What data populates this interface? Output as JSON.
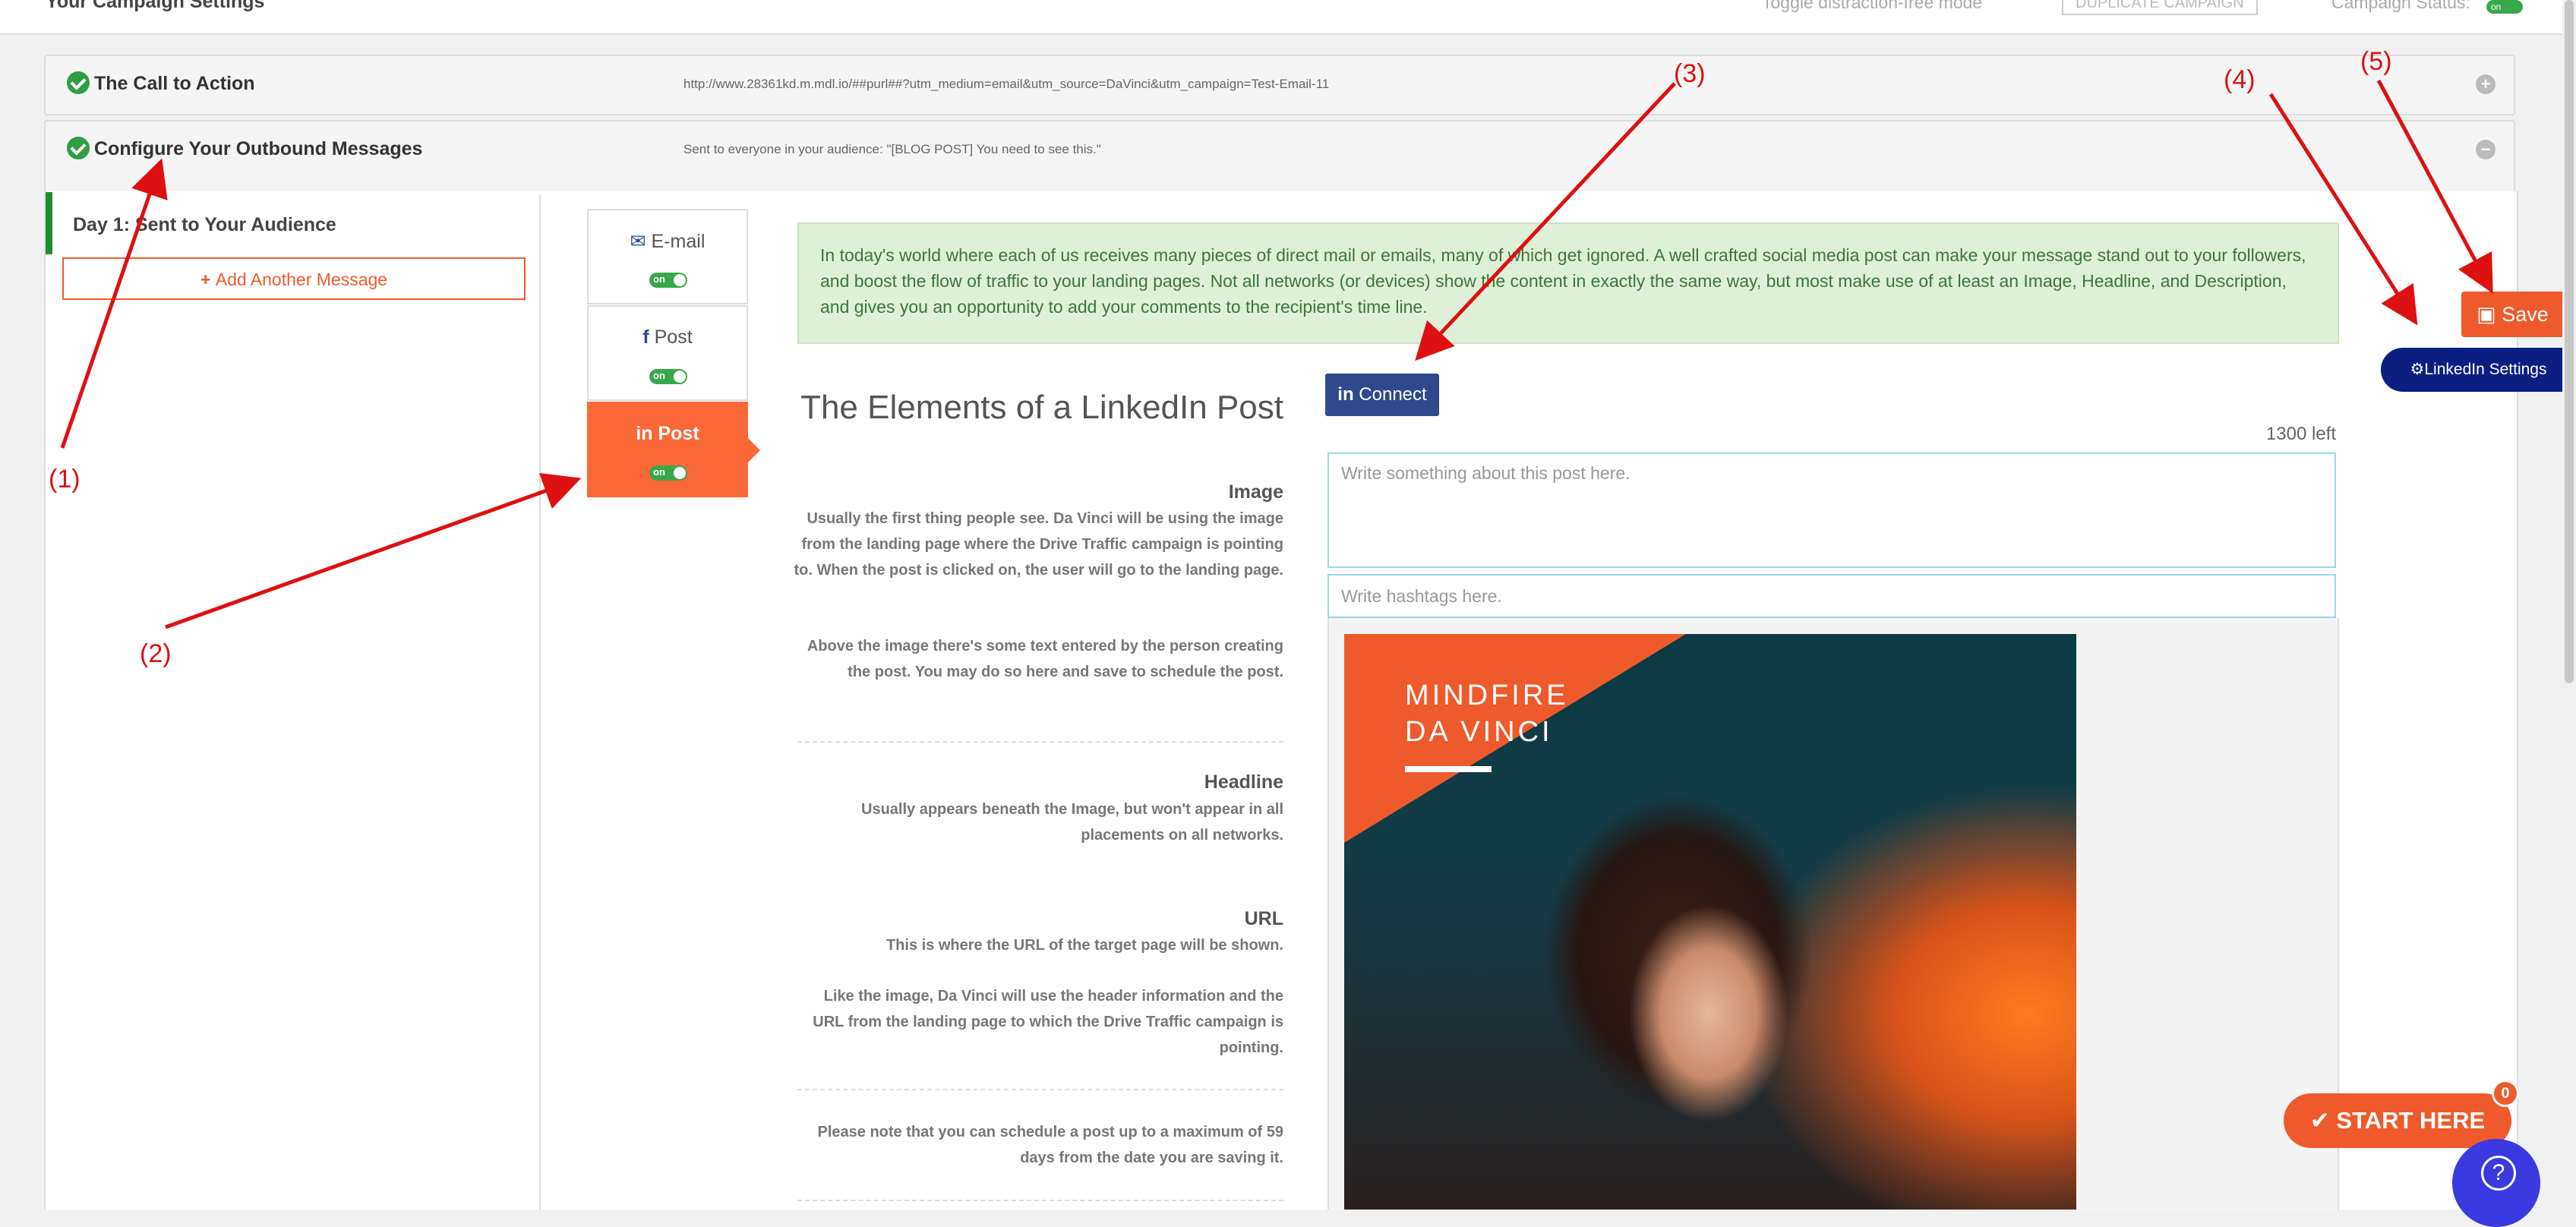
{
  "topbar": {
    "title": "Your Campaign Settings",
    "toggle_mode": "Toggle distraction-free mode",
    "duplicate": "DUPLICATE CAMPAIGN",
    "status_label": "Campaign Status:",
    "status_toggle": "on"
  },
  "panels": {
    "cta": {
      "title": "The Call to Action",
      "info": "http://www.28361kd.m.mdl.io/##purl##?utm_medium=email&utm_source=DaVinci&utm_campaign=Test-Email-11"
    },
    "outbound": {
      "title": "Configure Your Outbound Messages",
      "info": "Sent to everyone in your audience: \"[BLOG POST] You need to see this.\""
    }
  },
  "day": {
    "title": "Day 1: Sent to Your Audience",
    "add_message": "Add Another Message"
  },
  "channels": [
    {
      "label": "E-mail",
      "toggle": "on"
    },
    {
      "label": "Post",
      "toggle": "on"
    },
    {
      "label": "Post",
      "toggle": "on"
    }
  ],
  "info_text": "In today's world where each of us receives many pieces of direct mail or emails, many of which get ignored. A well crafted social media post can make your message stand out to your followers, and boost the flow of traffic to your landing pages. Not all networks (or devices) show the content in exactly the same way, but most make use of at least an Image, Headline, and Description, and gives you an opportunity to add your comments to the recipient's time line.",
  "elements": {
    "title": "The Elements of a LinkedIn Post",
    "image_heading": "Image",
    "image_desc1": "Usually the first thing people see. Da Vinci will be using the image from the landing page where the Drive Traffic campaign is pointing to. When the post is clicked on, the user will go to the landing page.",
    "image_desc2": "Above the image there's some text entered by the person creating the post. You may do so here and save to schedule the post.",
    "headline_heading": "Headline",
    "headline_desc": "Usually appears beneath the Image, but won't appear in all placements on all networks.",
    "url_heading": "URL",
    "url_desc1": "This is where the URL of the target page will be shown.",
    "url_desc2": "Like the image, Da Vinci will use the header information and the URL from the landing page to which the Drive Traffic campaign is pointing.",
    "note": "Please note that you can schedule a post up to a maximum of 59 days from the date you are saving it."
  },
  "linkedin": {
    "connect": "Connect",
    "counter": "1300 left",
    "post_placeholder": "Write something about this post here.",
    "hashtag_placeholder": "Write hashtags here."
  },
  "preview": {
    "brand_line1": "MINDFIRE",
    "brand_line2": "DA VINCI"
  },
  "buttons": {
    "save": "Save",
    "linkedin_settings": "LinkedIn Settings",
    "start_here": "START HERE",
    "start_badge": "0"
  },
  "annotations": [
    "(1)",
    "(2)",
    "(3)",
    "(4)",
    "(5)"
  ],
  "colors": {
    "accent": "#ee5a2c",
    "success": "#2e9d44",
    "linkedin": "#2e4a8d",
    "navy": "#0b1e82",
    "annotation": "#dd1111"
  }
}
